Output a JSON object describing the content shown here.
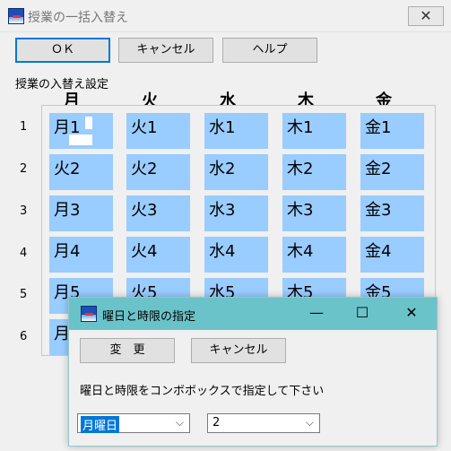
{
  "main": {
    "title": "授業の一括入替え",
    "close_glyph": "✕",
    "buttons": {
      "ok": "ＯＫ",
      "cancel": "キャンセル",
      "help": "ヘルプ"
    },
    "group_label": "授業の入替え設定",
    "days": [
      "月",
      "火",
      "水",
      "木",
      "金"
    ],
    "rows": [
      "1",
      "2",
      "3",
      "4",
      "5",
      "6"
    ],
    "grid": [
      [
        "月1",
        "火1",
        "水1",
        "木1",
        "金1"
      ],
      [
        "火2",
        "火2",
        "水2",
        "木2",
        "金2"
      ],
      [
        "月3",
        "火3",
        "水3",
        "木3",
        "金3"
      ],
      [
        "月4",
        "火4",
        "水4",
        "木4",
        "金4"
      ],
      [
        "月5",
        "火5",
        "水5",
        "木5",
        "金5"
      ],
      [
        "月",
        "",
        "",
        "",
        ""
      ]
    ],
    "cell_color": "#99ccff"
  },
  "dialog": {
    "title": "曜日と時限の指定",
    "controls": {
      "minimize": "—",
      "maximize": "☐",
      "close": "✕"
    },
    "change_button": "変　更",
    "cancel_button": "キャンセル",
    "instruction": "曜日と時限をコンボボックスで指定して下さい",
    "day_combo": {
      "value": "月曜日"
    },
    "period_combo": {
      "value": "2"
    },
    "titlebar_color": "#6ac3c9"
  }
}
